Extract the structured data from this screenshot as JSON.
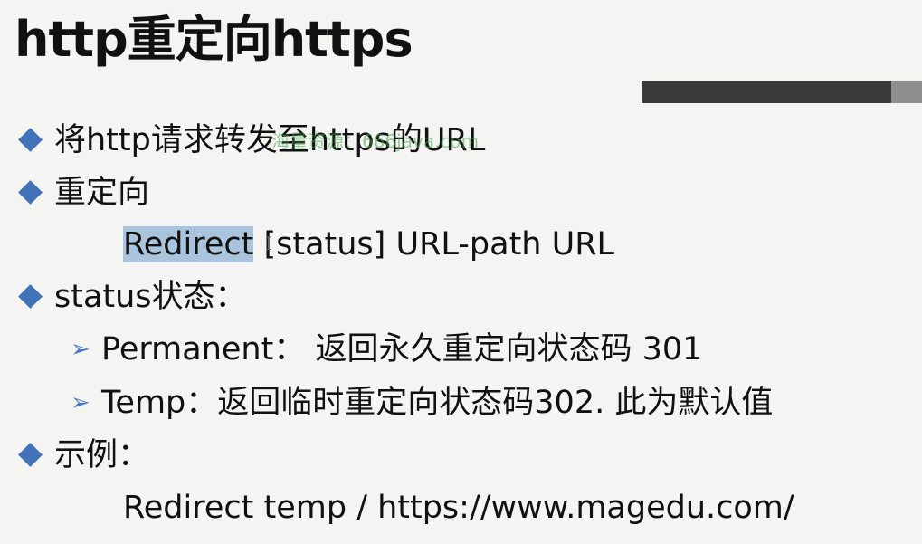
{
  "title": "http重定向https",
  "bullets": {
    "b1": "将http请求转发至https的URL",
    "b2": "重定向",
    "b2_code_selected": "Redirect",
    "b2_code_rest": " [status] URL-path URL",
    "b3": "status状态：",
    "b3_sub1": "Permanent： 返回永久重定向状态码 301",
    "b3_sub2": "Temp：返回临时重定向状态码302. 此为默认值",
    "b4": "示例：",
    "b4_example": "Redirect temp / https://www.magedu.com/"
  },
  "watermark": "海量资源：666java.com",
  "colors": {
    "bullet": "#4272b8",
    "arrow": "#4a78c2",
    "selection": "#a9c4dc",
    "bar": "#3a3a3a"
  }
}
